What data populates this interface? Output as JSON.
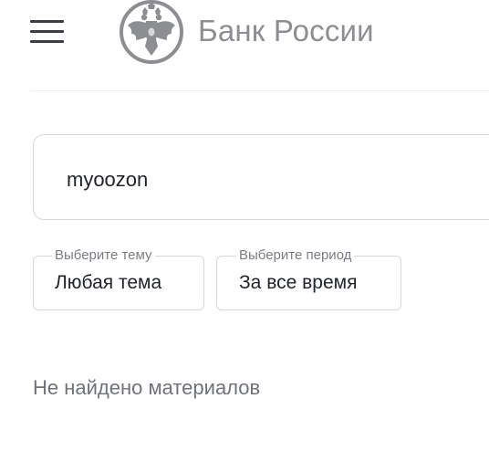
{
  "header": {
    "menu_icon": "hamburger-icon",
    "logo_icon": "double-headed-eagle-emblem",
    "logo_text": "Банк России"
  },
  "search": {
    "value": "myoozon"
  },
  "filters": {
    "topic": {
      "label": "Выберите тему",
      "value": "Любая тема"
    },
    "period": {
      "label": "Выберите период",
      "value": "За все время"
    }
  },
  "results": {
    "empty_message": "Не найдено материалов"
  },
  "colors": {
    "logo_gray": "#8c8e92",
    "border": "#d6d8db",
    "text": "#1f2329",
    "muted_text": "#6f7379"
  }
}
